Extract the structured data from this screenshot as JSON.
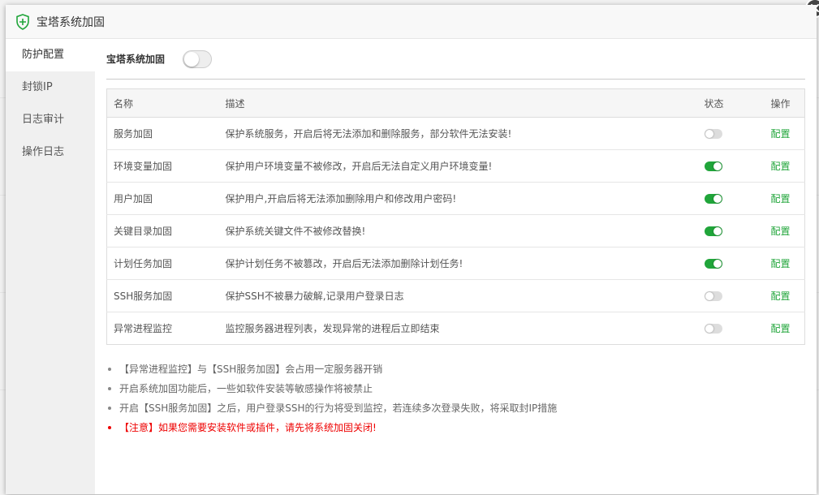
{
  "dialog": {
    "title": "宝塔系统加固"
  },
  "sidebar": {
    "items": [
      {
        "label": "防护配置",
        "active": true
      },
      {
        "label": "封锁IP",
        "active": false
      },
      {
        "label": "日志审计",
        "active": false
      },
      {
        "label": "操作日志",
        "active": false
      }
    ]
  },
  "main_toggle": {
    "label": "宝塔系统加固",
    "enabled": false
  },
  "table": {
    "headers": {
      "name": "名称",
      "desc": "描述",
      "status": "状态",
      "action": "操作"
    },
    "rows": [
      {
        "name": "服务加固",
        "desc": "保护系统服务，开启后将无法添加和删除服务，部分软件无法安装!",
        "status": "off",
        "action": "配置"
      },
      {
        "name": "环境变量加固",
        "desc": "保护用户环境变量不被修改，开启后无法自定义用户环境变量!",
        "status": "on",
        "action": "配置"
      },
      {
        "name": "用户加固",
        "desc": "保护用户,开启后将无法添加删除用户和修改用户密码!",
        "status": "on",
        "action": "配置"
      },
      {
        "name": "关键目录加固",
        "desc": "保护系统关键文件不被修改替换!",
        "status": "on",
        "action": "配置"
      },
      {
        "name": "计划任务加固",
        "desc": "保护计划任务不被篡改，开启后无法添加删除计划任务!",
        "status": "on",
        "action": "配置"
      },
      {
        "name": "SSH服务加固",
        "desc": "保护SSH不被暴力破解,记录用户登录日志",
        "status": "off",
        "action": "配置"
      },
      {
        "name": "异常进程监控",
        "desc": "监控服务器进程列表，发现异常的进程后立即结束",
        "status": "off",
        "action": "配置"
      }
    ]
  },
  "notes": [
    {
      "text": "【异常进程监控】与【SSH服务加固】会占用一定服务器开销",
      "warn": false
    },
    {
      "text": "开启系统加固功能后，一些如软件安装等敏感操作将被禁止",
      "warn": false
    },
    {
      "text": "开启【SSH服务加固】之后，用户登录SSH的行为将受到监控，若连续多次登录失败，将采取封IP措施",
      "warn": false
    },
    {
      "text": "【注意】如果您需要安装软件或插件，请先将系统加固关闭!",
      "warn": true
    }
  ],
  "colors": {
    "accent": "#20a53a",
    "warning": "#e00000"
  },
  "icons": {
    "title_icon": "shield-plus-icon",
    "close_icon": "close-icon"
  }
}
